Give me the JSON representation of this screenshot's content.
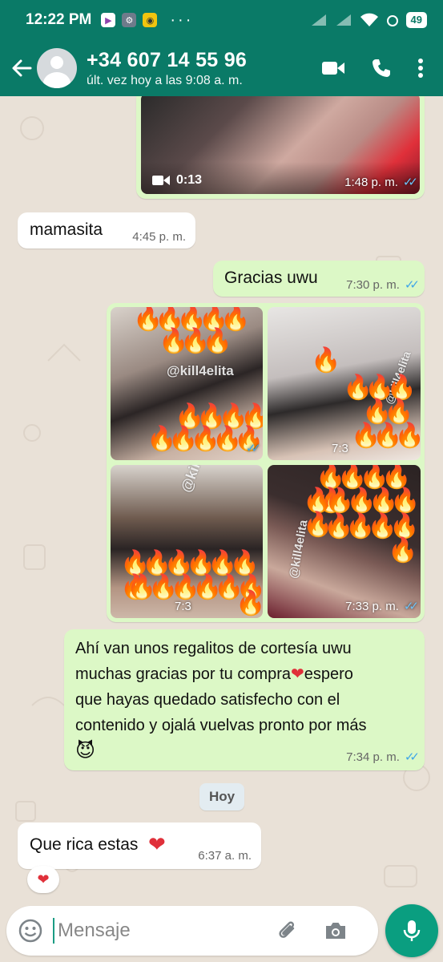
{
  "statusbar": {
    "time": "12:22 PM",
    "dots": "···",
    "battery": "49"
  },
  "header": {
    "contact_name": "+34 607 14 55 96",
    "last_seen": "últ. vez hoy a las 9:08 a. m."
  },
  "messages": {
    "video": {
      "duration": "0:13",
      "time": "1:48 p. m."
    },
    "m1": {
      "text": "mamasita",
      "time": "4:45 p. m."
    },
    "m2": {
      "text": "Gracias uwu",
      "time": "7:30 p. m."
    },
    "photos": {
      "watermark": "@kill4elita",
      "time_a": "7:3",
      "time_b": "7:3",
      "time_c": "7:33 p. m.",
      "time_d": "7:33 p. m."
    },
    "m3": {
      "line1": "Ahí van unos regalitos de cortesía uwu",
      "line2a": "muchas gracias por tu compra",
      "line2b": "espero",
      "line3": "que hayas quedado satisfecho con el",
      "line4": "contenido y ojalá vuelvas pronto por más",
      "emoji": "😈",
      "time": "7:34 p. m."
    },
    "day_chip": "Hoy",
    "m4": {
      "text": "Que rica estas",
      "time": "6:37 a. m."
    },
    "reaction": "❤"
  },
  "composer": {
    "placeholder": "Mensaje"
  },
  "colors": {
    "header": "#0a7a67",
    "outgoing": "#dcf8c6",
    "incoming": "#ffffff",
    "ticks": "#3fa6e8",
    "mic": "#0a9e80"
  },
  "icons": [
    "back-arrow-icon",
    "video-call-icon",
    "phone-icon",
    "more-vert-icon",
    "emoji-icon",
    "attach-icon",
    "camera-icon",
    "mic-icon",
    "double-check-icon",
    "video-icon",
    "fire-emoji"
  ]
}
